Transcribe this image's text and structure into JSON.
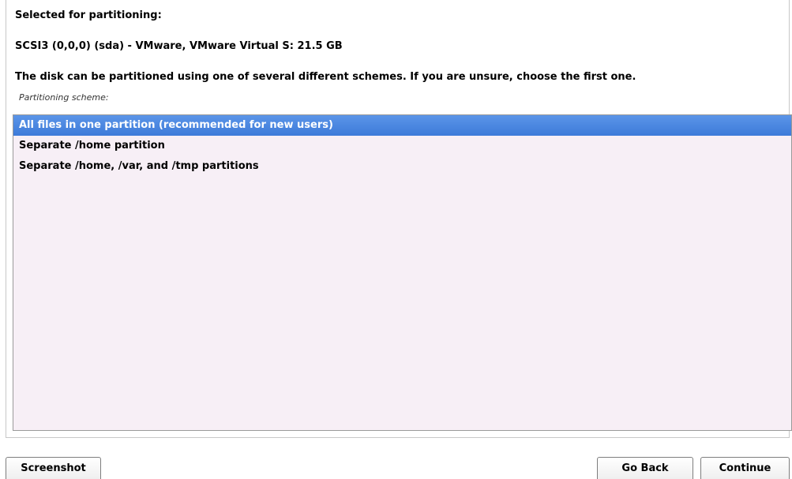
{
  "header": {
    "selected_label": "Selected for partitioning:",
    "disk_name": "SCSI3 (0,0,0) (sda) - VMware, VMware Virtual S: 21.5 GB",
    "instructions": "The disk can be partitioned using one of several different schemes. If you are unsure, choose the first one."
  },
  "scheme": {
    "label": "Partitioning scheme:",
    "options": [
      "All files in one partition (recommended for new users)",
      "Separate /home partition",
      "Separate /home, /var, and /tmp partitions"
    ],
    "selected_index": 0
  },
  "buttons": {
    "screenshot": "Screenshot",
    "go_back": "Go Back",
    "continue": "Continue"
  },
  "colors": {
    "selection": "#4a86e0",
    "list_background": "#f7eff6"
  }
}
